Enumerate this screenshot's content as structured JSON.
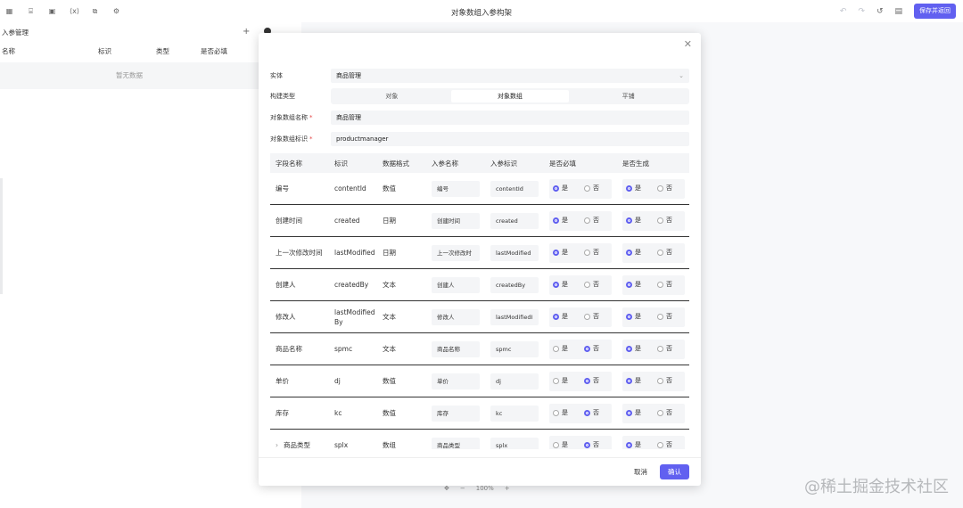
{
  "topbar": {
    "title": "对象数组入参构架",
    "icons": [
      "grid-icon",
      "code-icon",
      "image-icon",
      "variable-icon",
      "copy-icon",
      "gear-icon"
    ],
    "save_return_label": "保存并返回"
  },
  "left_panel": {
    "title": "入参管理",
    "columns": [
      "名称",
      "标识",
      "类型",
      "是否必填"
    ],
    "empty_text": "暂无数据"
  },
  "zoom": {
    "minus": "−",
    "value": "100%",
    "plus": "+"
  },
  "watermark": "@稀土掘金技术社区",
  "modal": {
    "entity_label": "实体",
    "entity_value": "商品管理",
    "build_type_label": "构建类型",
    "build_types": [
      "对象",
      "对象数组",
      "平铺"
    ],
    "build_type_selected": "对象数组",
    "array_name_label": "对象数组名称",
    "array_name_value": "商品管理",
    "array_id_label": "对象数组标识",
    "array_id_value": "productmanager",
    "table": {
      "columns": [
        "字段名称",
        "标识",
        "数据格式",
        "入参名称",
        "入参标识",
        "是否必填",
        "是否生成"
      ],
      "yes": "是",
      "no": "否",
      "rows": [
        {
          "field": "编号",
          "id": "contentId",
          "format": "数值",
          "param_name": "编号",
          "param_id": "contentId",
          "required": true,
          "generate": true
        },
        {
          "field": "创建时间",
          "id": "created",
          "format": "日期",
          "param_name": "创建时间",
          "param_id": "created",
          "required": true,
          "generate": true
        },
        {
          "field": "上一次修改时间",
          "id": "lastModified",
          "format": "日期",
          "param_name": "上一次修改时",
          "param_id": "lastModified",
          "required": true,
          "generate": true
        },
        {
          "field": "创建人",
          "id": "createdBy",
          "format": "文本",
          "param_name": "创建人",
          "param_id": "createdBy",
          "required": true,
          "generate": true
        },
        {
          "field": "修改人",
          "id": "lastModifiedBy",
          "format": "文本",
          "param_name": "修改人",
          "param_id": "lastModifiedI",
          "required": true,
          "generate": true
        },
        {
          "field": "商品名称",
          "id": "spmc",
          "format": "文本",
          "param_name": "商品名称",
          "param_id": "spmc",
          "required": false,
          "generate": true
        },
        {
          "field": "单价",
          "id": "dj",
          "format": "数值",
          "param_name": "单价",
          "param_id": "dj",
          "required": false,
          "generate": true
        },
        {
          "field": "库存",
          "id": "kc",
          "format": "数值",
          "param_name": "库存",
          "param_id": "kc",
          "required": false,
          "generate": true
        },
        {
          "field": "商品类型",
          "id": "splx",
          "format": "数组",
          "param_name": "商品类型",
          "param_id": "splx",
          "required": false,
          "generate": true,
          "expandable": true
        }
      ]
    },
    "cancel_label": "取消",
    "confirm_label": "确认"
  }
}
